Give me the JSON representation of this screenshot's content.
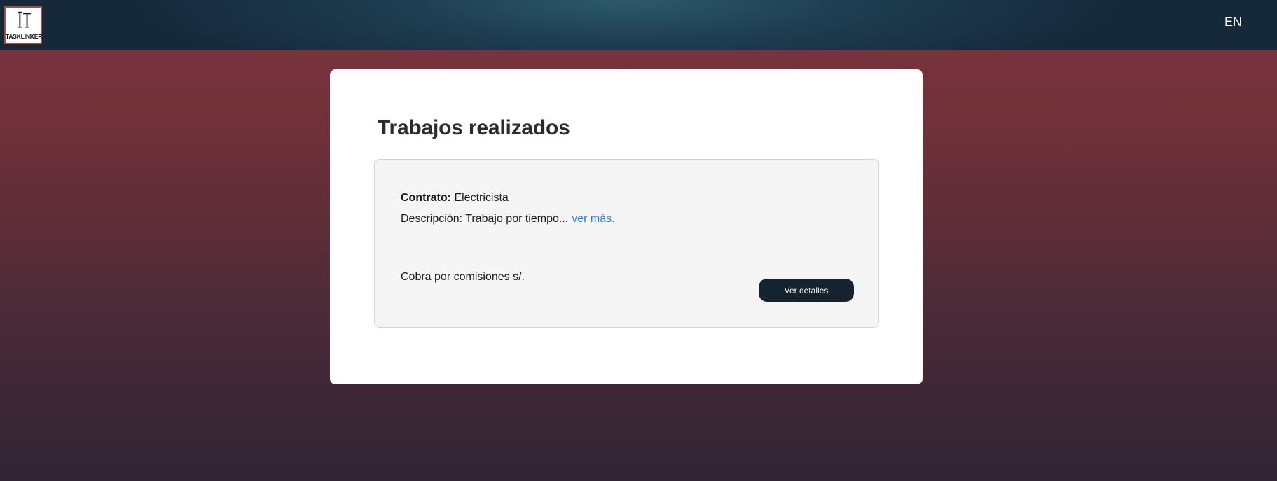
{
  "header": {
    "logo_text": "TASKLINKER",
    "language": "EN"
  },
  "main": {
    "title": "Trabajos realizados",
    "job": {
      "contract_label": "Contrato:",
      "contract_value": "Electricista",
      "description_text": "Descripción: Trabajo por tiempo...",
      "read_more_label": "ver más.",
      "commission_text": "Cobra por comisiones s/.",
      "details_button_label": "Ver detalles"
    }
  }
}
